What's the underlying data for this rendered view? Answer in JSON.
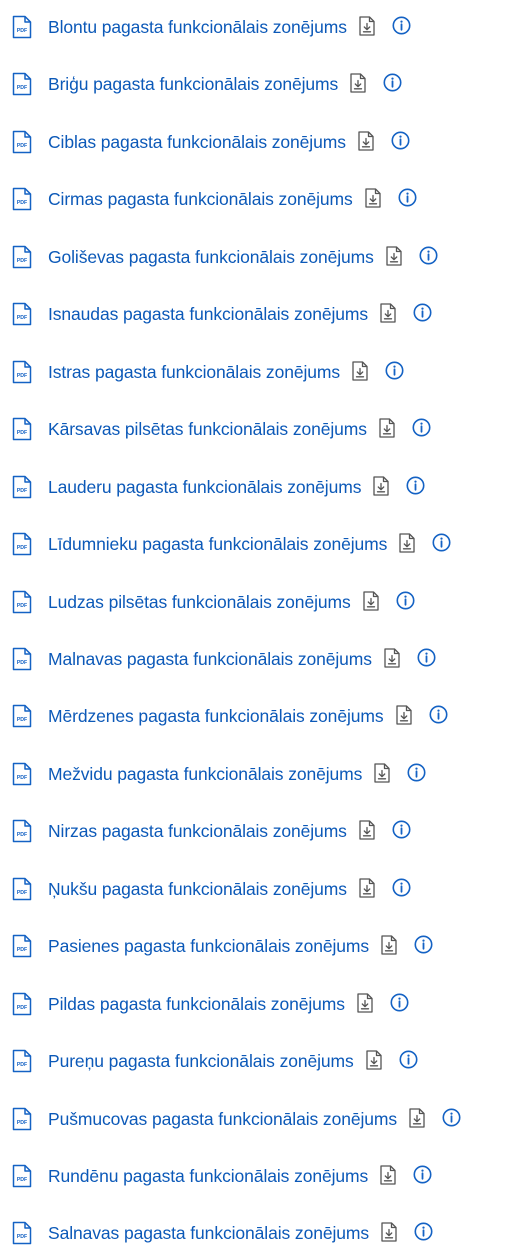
{
  "colors": {
    "link": "#0c59b8",
    "icon_blue": "#1462c4",
    "download_icon": "#555555"
  },
  "icons": {
    "file": "pdf-file-icon",
    "download": "download-icon",
    "info": "info-icon"
  },
  "pdf_badge_text": "PDF",
  "files": [
    {
      "title": "Blontu pagasta funkcionālais zonējums"
    },
    {
      "title": "Briģu pagasta funkcionālais zonējums"
    },
    {
      "title": "Ciblas pagasta funkcionālais zonējums"
    },
    {
      "title": "Cirmas pagasta funkcionālais zonējums"
    },
    {
      "title": "Goliševas pagasta funkcionālais zonējums"
    },
    {
      "title": "Isnaudas pagasta funkcionālais zonējums"
    },
    {
      "title": "Istras pagasta funkcionālais zonējums"
    },
    {
      "title": "Kārsavas pilsētas funkcionālais zonējums"
    },
    {
      "title": "Lauderu pagasta funkcionālais zonējums"
    },
    {
      "title": "Līdumnieku pagasta funkcionālais zonējums"
    },
    {
      "title": "Ludzas pilsētas funkcionālais zonējums"
    },
    {
      "title": "Malnavas pagasta funkcionālais zonējums"
    },
    {
      "title": "Mērdzenes pagasta funkcionālais zonējums"
    },
    {
      "title": "Mežvidu pagasta funkcionālais zonējums"
    },
    {
      "title": "Nirzas pagasta funkcionālais zonējums"
    },
    {
      "title": "Ņukšu pagasta funkcionālais zonējums"
    },
    {
      "title": "Pasienes pagasta funkcionālais zonējums"
    },
    {
      "title": "Pildas pagasta funkcionālais zonējums"
    },
    {
      "title": "Pureņu pagasta funkcionālais zonējums"
    },
    {
      "title": "Pušmucovas pagasta funkcionālais zonējums"
    },
    {
      "title": "Rundēnu pagasta funkcionālais zonējums"
    },
    {
      "title": "Salnavas pagasta funkcionālais zonējums"
    }
  ]
}
